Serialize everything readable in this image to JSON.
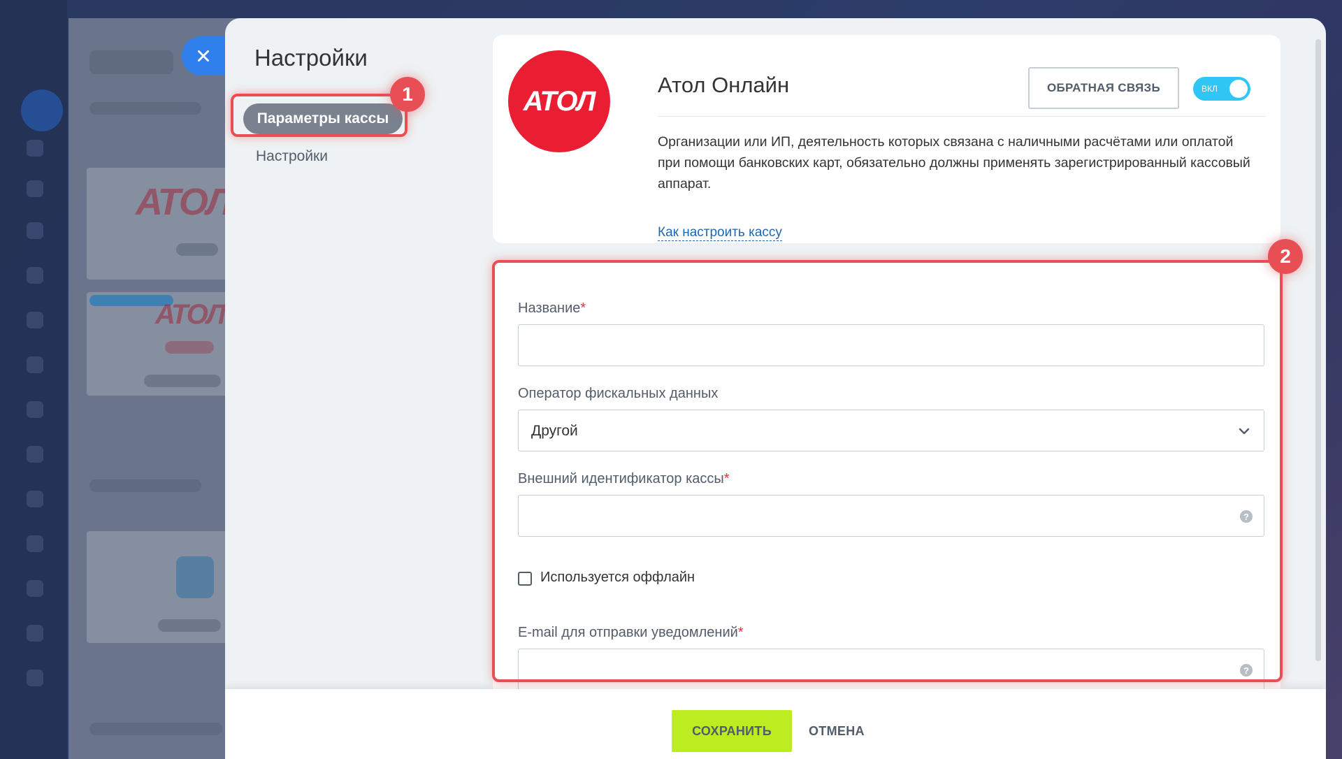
{
  "panel": {
    "title": "Настройки",
    "nav": [
      {
        "label": "Параметры кассы",
        "active": true
      },
      {
        "label": "Настройки",
        "active": false
      }
    ]
  },
  "provider": {
    "logo_text": "АТОЛ",
    "name": "Атол Онлайн",
    "feedback_label": "ОБРАТНАЯ СВЯЗЬ",
    "toggle_label": "ВКЛ",
    "toggle_on": true,
    "description": "Организации или ИП, деятельность которых связана с наличными расчётами или оплатой при помощи банковских карт, обязательно должны применять зарегистрированный кассовый аппарат.",
    "setup_link": "Как настроить кассу"
  },
  "form": {
    "name_label": "Название",
    "name_value": "",
    "ofd_label": "Оператор фискальных данных",
    "ofd_value": "Другой",
    "external_id_label": "Внешний идентификатор кассы",
    "external_id_value": "",
    "offline_label": "Используется оффлайн",
    "offline_checked": false,
    "email_label": "E-mail для отправки уведомлений",
    "email_value": "",
    "required_mark": "*"
  },
  "annotations": {
    "badge_1": "1",
    "badge_2": "2"
  },
  "footer": {
    "save_label": "СОХРАНИТЬ",
    "cancel_label": "ОТМЕНА"
  },
  "colors": {
    "accent_blue": "#2f80ed",
    "logo_red": "#e91e32",
    "toggle_blue": "#2fc6f6",
    "save_green": "#bbed21",
    "highlight_red": "#e84f55",
    "link_blue": "#2067b0"
  }
}
